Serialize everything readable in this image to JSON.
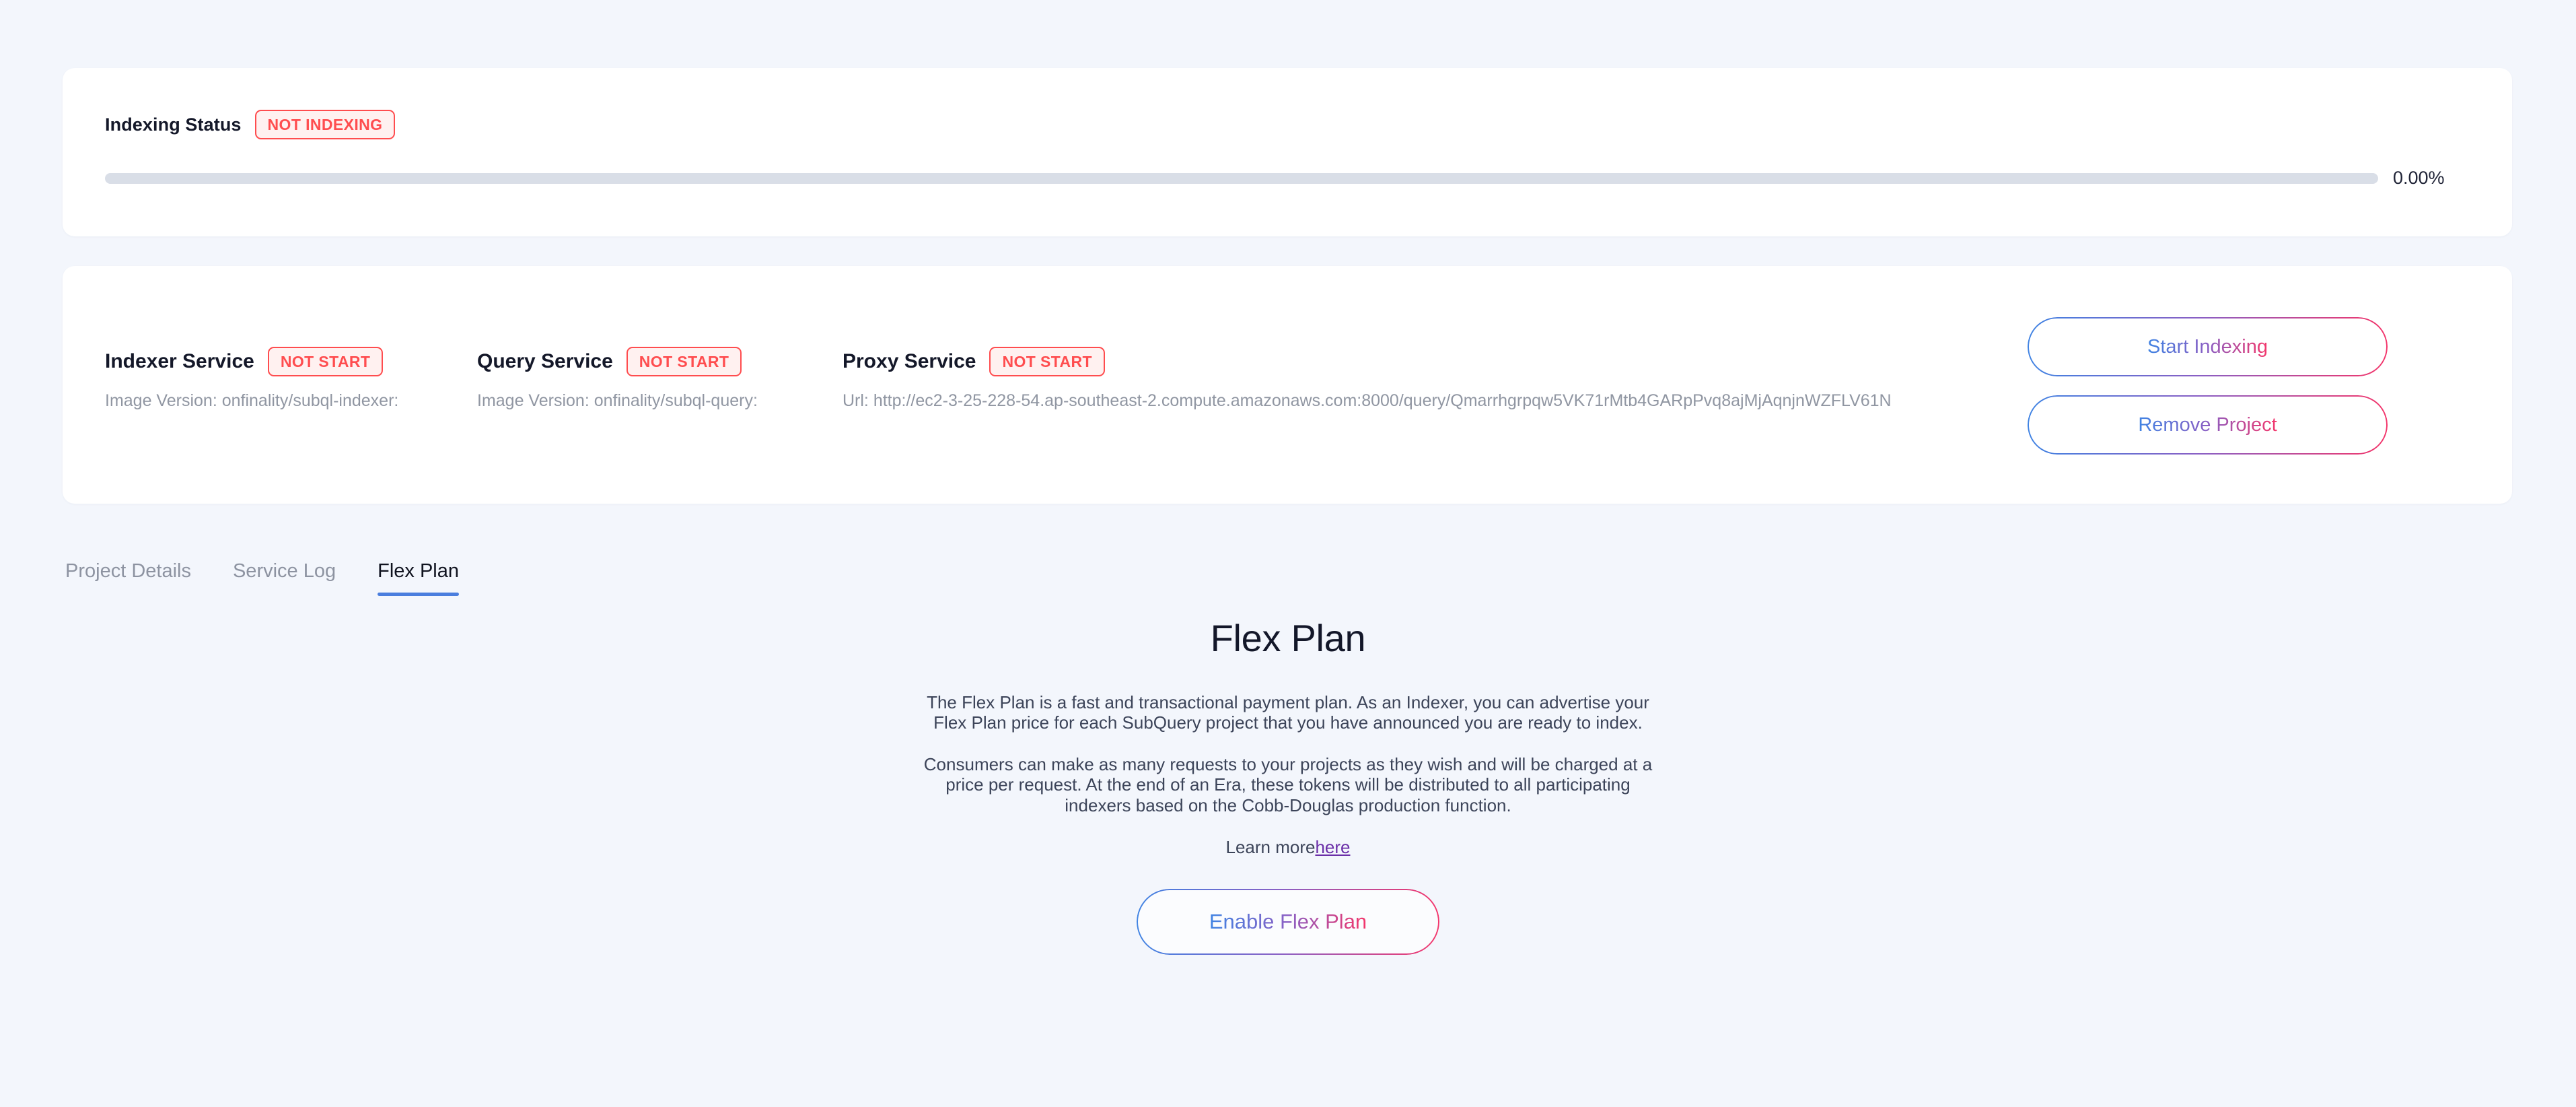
{
  "indexing": {
    "label": "Indexing Status",
    "status_badge": "NOT INDEXING",
    "progress_value": "0.00%",
    "progress_percent": 0
  },
  "services": [
    {
      "name": "Indexer Service",
      "status": "NOT START",
      "detail": "Image Version: onfinality/subql-indexer:"
    },
    {
      "name": "Query Service",
      "status": "NOT START",
      "detail": "Image Version: onfinality/subql-query:"
    },
    {
      "name": "Proxy Service",
      "status": "NOT START",
      "detail": "Url: http://ec2-3-25-228-54.ap-southeast-2.compute.amazonaws.com:8000/query/Qmarrhgrpqw5VK71rMtb4GARpPvq8ajMjAqnjnWZFLV61N"
    }
  ],
  "actions": {
    "start_indexing": "Start Indexing",
    "remove_project": "Remove Project"
  },
  "tabs": [
    {
      "label": "Project Details",
      "active": false
    },
    {
      "label": "Service Log",
      "active": false
    },
    {
      "label": "Flex Plan",
      "active": true
    }
  ],
  "flex_plan": {
    "title": "Flex Plan",
    "paragraph_1": "The Flex Plan is a fast and transactional payment plan. As an Indexer, you can advertise your Flex Plan price for each SubQuery project that you have announced you are ready to index.",
    "paragraph_2": "Consumers can make as many requests to your projects as they wish and will be charged at a price per request. At the end of an Era, these tokens will be distributed to all participating indexers based on the Cobb-Douglas production function.",
    "learn_more_text": "Learn more",
    "learn_more_link": "here",
    "enable_button": "Enable Flex Plan"
  },
  "colors": {
    "page_background": "#f3f6fc",
    "card_background": "#ffffff",
    "danger": "#ff4d4f",
    "danger_background": "#fff1f0",
    "gradient_start": "#3f83e3",
    "gradient_end": "#f4366b",
    "tab_active_underline": "#4a7ede",
    "link": "#6b2fa8",
    "progress_track": "#d9dee7"
  }
}
